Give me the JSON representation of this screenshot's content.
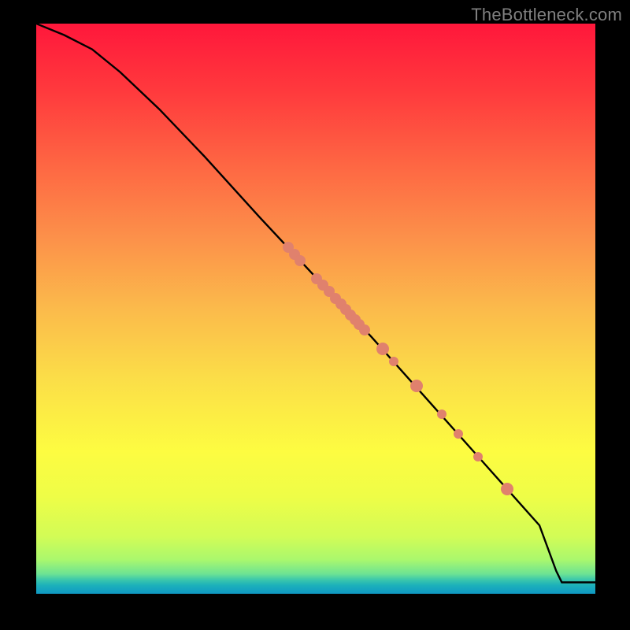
{
  "watermark": "TheBottleneck.com",
  "chart_data": {
    "type": "line",
    "title": "",
    "xlabel": "",
    "ylabel": "",
    "xlim": [
      0,
      100
    ],
    "ylim": [
      0,
      100
    ],
    "x": [
      0,
      5,
      10,
      15,
      22,
      30,
      40,
      50,
      60,
      70,
      80,
      90,
      93,
      94,
      100
    ],
    "y": [
      100,
      98,
      95.5,
      91.5,
      85,
      76.8,
      66,
      55.5,
      45,
      34,
      23,
      12,
      4,
      2,
      2
    ],
    "markers": [
      {
        "x": 45.0,
        "y": 60.8,
        "r": 7
      },
      {
        "x": 46.2,
        "y": 59.5,
        "r": 7
      },
      {
        "x": 47.2,
        "y": 58.4,
        "r": 7
      },
      {
        "x": 50.2,
        "y": 55.3,
        "r": 7
      },
      {
        "x": 51.3,
        "y": 54.1,
        "r": 7
      },
      {
        "x": 52.4,
        "y": 53.0,
        "r": 7
      },
      {
        "x": 53.5,
        "y": 51.8,
        "r": 7
      },
      {
        "x": 54.5,
        "y": 50.8,
        "r": 7
      },
      {
        "x": 55.4,
        "y": 49.8,
        "r": 7
      },
      {
        "x": 56.2,
        "y": 48.9,
        "r": 7
      },
      {
        "x": 57.0,
        "y": 48.1,
        "r": 7
      },
      {
        "x": 57.8,
        "y": 47.2,
        "r": 7
      },
      {
        "x": 58.7,
        "y": 46.3,
        "r": 7
      },
      {
        "x": 62.0,
        "y": 42.9,
        "r": 8
      },
      {
        "x": 64.0,
        "y": 40.7,
        "r": 6
      },
      {
        "x": 68.0,
        "y": 36.5,
        "r": 8
      },
      {
        "x": 72.5,
        "y": 31.5,
        "r": 6
      },
      {
        "x": 75.5,
        "y": 28.0,
        "r": 6
      },
      {
        "x": 79.0,
        "y": 24.1,
        "r": 6
      },
      {
        "x": 84.2,
        "y": 18.4,
        "r": 8
      }
    ],
    "gradient_stops": [
      {
        "pos": 0.0,
        "color": "#ff173b"
      },
      {
        "pos": 0.12,
        "color": "#ff3a3d"
      },
      {
        "pos": 0.25,
        "color": "#fe6743"
      },
      {
        "pos": 0.38,
        "color": "#fc924a"
      },
      {
        "pos": 0.5,
        "color": "#fbba4b"
      },
      {
        "pos": 0.62,
        "color": "#fbdd48"
      },
      {
        "pos": 0.75,
        "color": "#fdfc41"
      },
      {
        "pos": 0.83,
        "color": "#eefd47"
      },
      {
        "pos": 0.9,
        "color": "#d2fc56"
      },
      {
        "pos": 0.94,
        "color": "#aaf86d"
      },
      {
        "pos": 0.965,
        "color": "#6de393"
      },
      {
        "pos": 0.975,
        "color": "#3dc8ab"
      },
      {
        "pos": 0.985,
        "color": "#1db1ba"
      },
      {
        "pos": 1.0,
        "color": "#0f98c3"
      }
    ]
  }
}
